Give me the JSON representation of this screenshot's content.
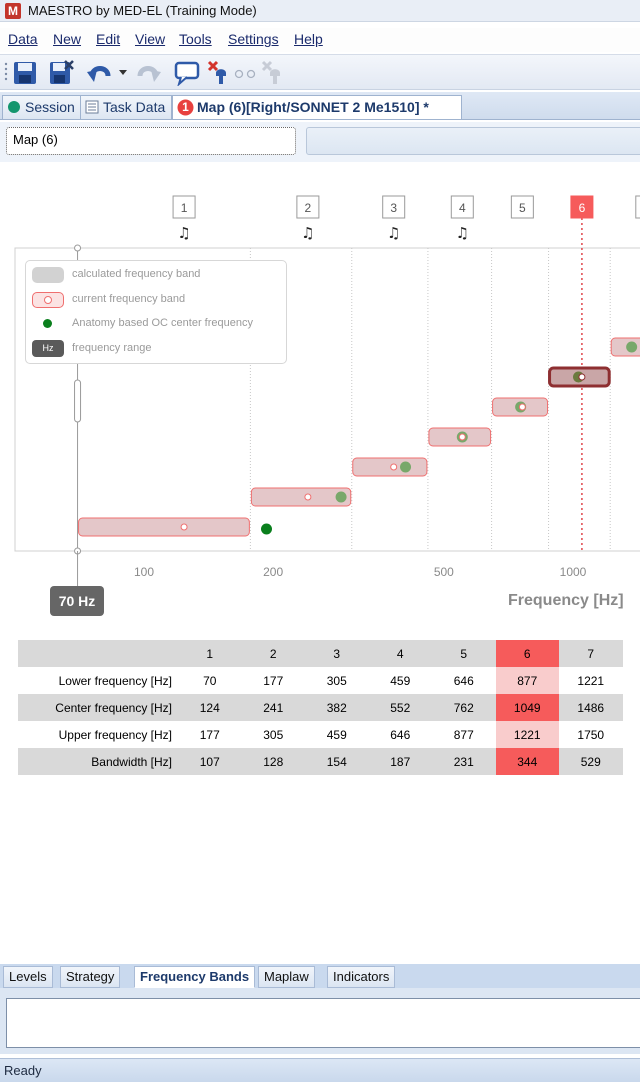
{
  "window": {
    "logo_letter": "M",
    "title": "MAESTRO by MED-EL (Training Mode)"
  },
  "menu": [
    "Data",
    "New",
    "Edit",
    "View",
    "Tools",
    "Settings",
    "Help"
  ],
  "menu_underline_index": [
    0,
    0,
    0,
    0,
    0,
    0,
    0
  ],
  "tabs": [
    {
      "label": "Session",
      "icon": "session-icon"
    },
    {
      "label": "Task Data",
      "icon": "task-data-icon"
    },
    {
      "label": "Map (6)[Right/SONNET 2 Me1510] *",
      "badge": "1",
      "icon": "warning-badge-icon"
    }
  ],
  "map": {
    "name": "Map (6)"
  },
  "chart_data": {
    "type": "range-bar",
    "xlabel": "Frequency [Hz]",
    "x_scale": "log",
    "x_ticks": [
      100,
      200,
      500,
      1000
    ],
    "x_tick_labels": [
      "100",
      "200",
      "500",
      "1000"
    ],
    "range_handle_label": "70 Hz",
    "channels": [
      "1",
      "2",
      "3",
      "4",
      "5",
      "6",
      "7"
    ],
    "channels_with_note": [
      "1",
      "2",
      "3",
      "4"
    ],
    "selected_channel": "6",
    "bands": [
      {
        "channel": "1",
        "lower": 70,
        "center": 124,
        "upper": 177,
        "oc": 193
      },
      {
        "channel": "2",
        "lower": 177,
        "center": 241,
        "upper": 305,
        "oc": 288
      },
      {
        "channel": "3",
        "lower": 305,
        "center": 382,
        "upper": 459,
        "oc": 407
      },
      {
        "channel": "4",
        "lower": 459,
        "center": 552,
        "upper": 646,
        "oc": 552
      },
      {
        "channel": "5",
        "lower": 646,
        "center": 762,
        "upper": 877,
        "oc": 755
      },
      {
        "channel": "6",
        "lower": 877,
        "center": 1049,
        "upper": 1221,
        "oc": 1030
      },
      {
        "channel": "7",
        "lower": 1221,
        "center": 1486,
        "upper": 1750,
        "oc": 1370
      }
    ],
    "legend": [
      {
        "label": "calculated frequency band",
        "swatch": "gray-band"
      },
      {
        "label": "current frequency band",
        "swatch": "red-band"
      },
      {
        "label": "Anatomy based OC center frequency",
        "swatch": "green-dot"
      },
      {
        "label": "frequency range",
        "swatch": "hz-box",
        "swatch_text": "Hz"
      }
    ],
    "legend_placement": "top-left",
    "colors": {
      "band_fill": "#e4c7c9",
      "band_stroke": "#ef6f6f",
      "selected_band": "#8e2f31",
      "oc_dot": "#0a7f1d",
      "oc_dot_light": "#78a86a",
      "selected_header": "#f65b5b"
    }
  },
  "table": {
    "headers": [
      "1",
      "2",
      "3",
      "4",
      "5",
      "6",
      "7"
    ],
    "rows": [
      {
        "label": "Lower frequency [Hz]",
        "values": [
          "70",
          "177",
          "305",
          "459",
          "646",
          "877",
          "1221"
        ]
      },
      {
        "label": "Center frequency [Hz]",
        "values": [
          "124",
          "241",
          "382",
          "552",
          "762",
          "1049",
          "1486"
        ]
      },
      {
        "label": "Upper frequency [Hz]",
        "values": [
          "177",
          "305",
          "459",
          "646",
          "877",
          "1221",
          "1750"
        ]
      },
      {
        "label": "Bandwidth [Hz]",
        "values": [
          "107",
          "128",
          "154",
          "187",
          "231",
          "344",
          "529"
        ]
      }
    ],
    "selected_index": 5
  },
  "bottom_tabs": [
    "Levels",
    "Strategy",
    "Frequency Bands",
    "Maplaw",
    "Indicators"
  ],
  "bottom_active": "Frequency Bands",
  "status": {
    "text": "Ready"
  }
}
